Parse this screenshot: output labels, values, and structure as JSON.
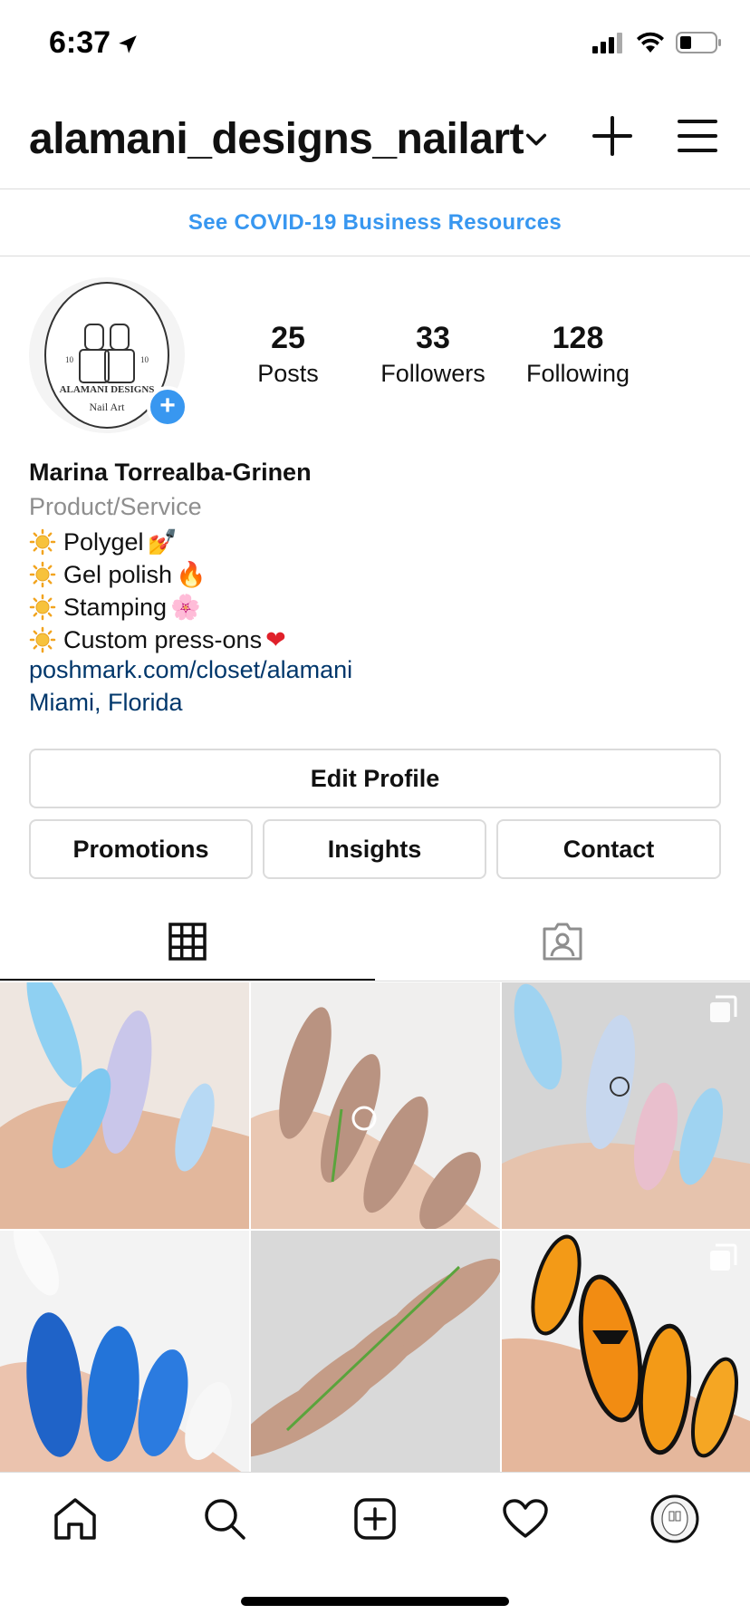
{
  "status_bar": {
    "time": "6:37"
  },
  "header": {
    "username": "alamani_designs_nailart"
  },
  "banner": {
    "text": "See COVID-19 Business Resources"
  },
  "profile": {
    "logo_line1": "ALAMANI DESIGNS",
    "logo_line2": "Nail Art",
    "logo_num_left": "10",
    "logo_num_right": "10",
    "stats": [
      {
        "value": "25",
        "label": "Posts"
      },
      {
        "value": "33",
        "label": "Followers"
      },
      {
        "value": "128",
        "label": "Following"
      }
    ],
    "name": "Marina Torrealba-Grinen",
    "category": "Product/Service",
    "bio_lines": [
      {
        "text": "Polygel",
        "emoji": "💅"
      },
      {
        "text": "Gel polish",
        "emoji": "🔥"
      },
      {
        "text": "Stamping",
        "emoji": "🌸"
      },
      {
        "text": "Custom press-ons",
        "emoji": "❤"
      }
    ],
    "website": "poshmark.com/closet/alamani",
    "location": "Miami, Florida"
  },
  "buttons": {
    "edit_profile": "Edit Profile",
    "promotions": "Promotions",
    "insights": "Insights",
    "contact": "Contact"
  },
  "colors": {
    "accent": "#3897f0",
    "link": "#00376b",
    "secondary": "#8e8e8e",
    "border": "#dbdbdb"
  }
}
